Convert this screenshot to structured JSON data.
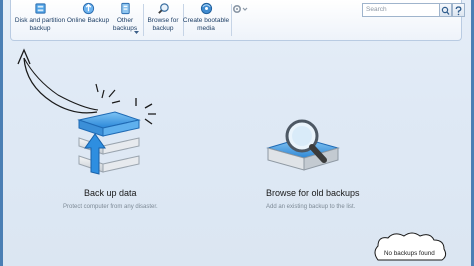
{
  "toolbar": {
    "disk_partition_backup": "Disk and partition\nbackup",
    "online_backup": "Online Backup",
    "other_backups": "Other\nbackups",
    "browse_backup": "Browse for\nbackup",
    "create_bootable": "Create bootable\nmedia"
  },
  "search": {
    "placeholder": "Search"
  },
  "backup": {
    "title": "Back up data",
    "subtitle": "Protect computer from any disaster."
  },
  "browse": {
    "title": "Browse for old backups",
    "subtitle": "Add an existing backup to the list."
  },
  "status": {
    "no_backups": "No backups found"
  },
  "colors": {
    "accent": "#1f7ad1",
    "toolbar_border": "#b9cbe2",
    "frame": "#4b7fb4"
  },
  "icons": [
    "disk-backup-icon",
    "online-backup-icon",
    "other-backups-icon",
    "browse-backup-icon",
    "bootable-media-icon",
    "tools-icon",
    "search-icon",
    "help-icon"
  ]
}
